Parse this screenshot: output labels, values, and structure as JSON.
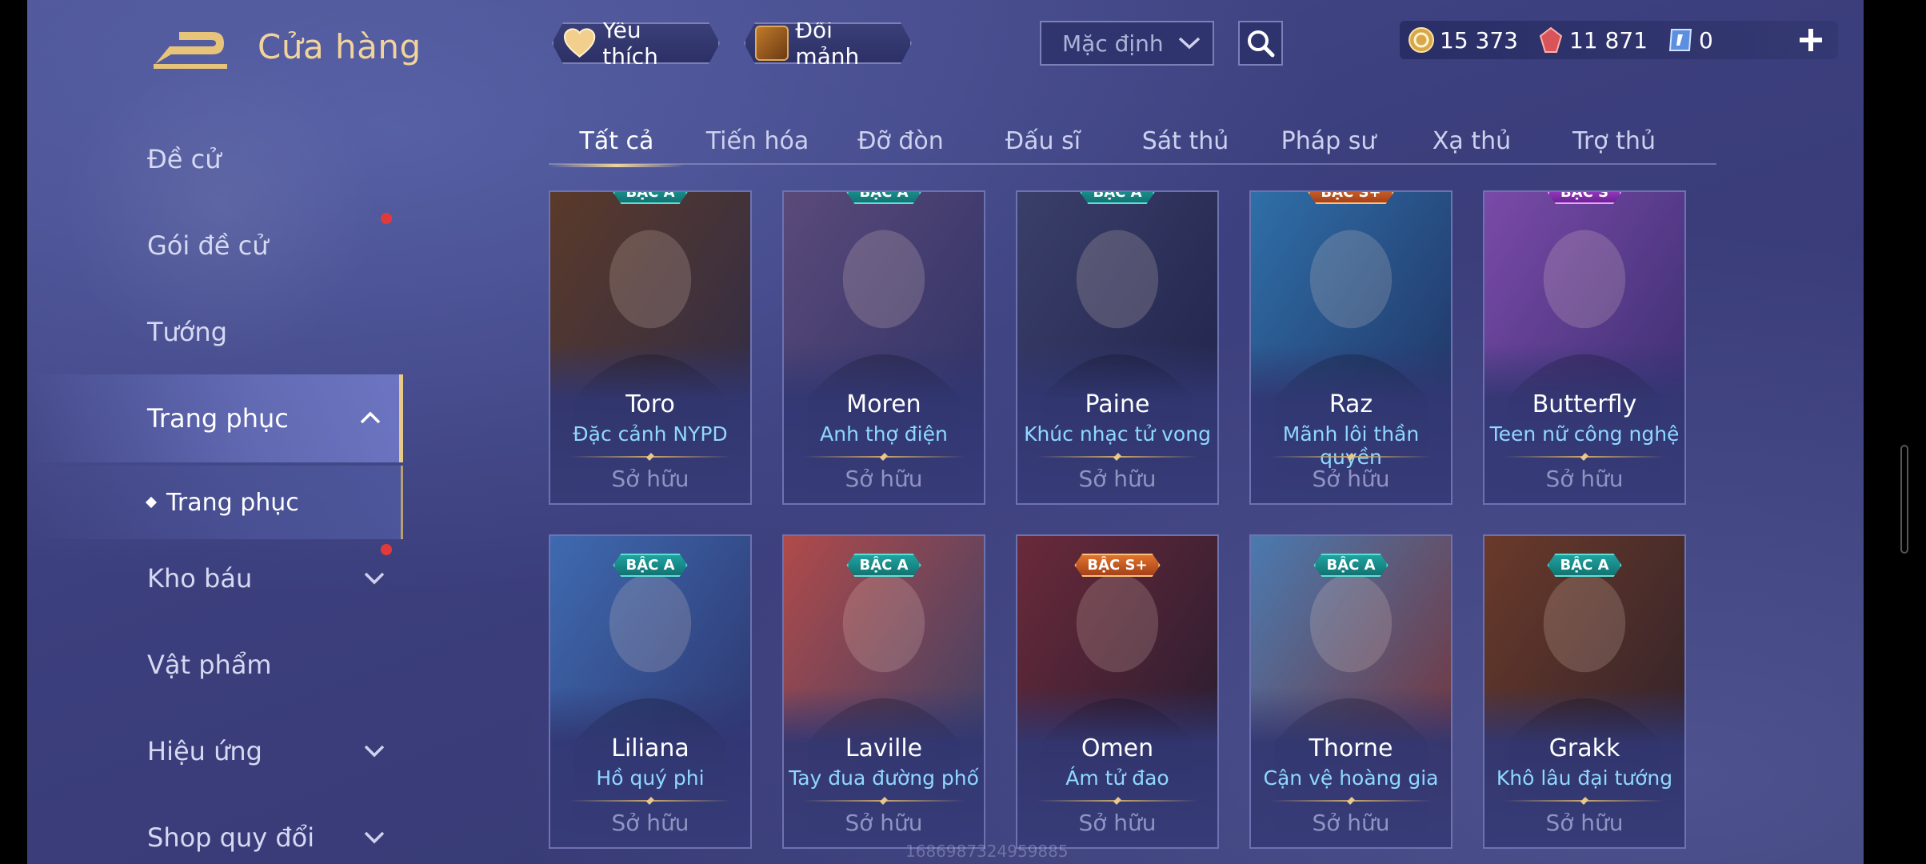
{
  "header": {
    "title": "Cửa hàng",
    "favorite_label": "Yêu thích",
    "shard_label": "Đổi mảnh",
    "sort": {
      "selected": "Mặc định"
    }
  },
  "currency": [
    {
      "icon": "gold-coin-icon",
      "value": "15 373"
    },
    {
      "icon": "ruby-gem-icon",
      "value": "11 871"
    },
    {
      "icon": "voucher-icon",
      "value": "0"
    }
  ],
  "sidebar": {
    "items": [
      {
        "label": "Đề cử"
      },
      {
        "label": "Gói đề cử"
      },
      {
        "label": "Tướng"
      },
      {
        "label": "Trang phục"
      },
      {
        "label": "Trang phục"
      },
      {
        "label": "Kho báu"
      },
      {
        "label": "Vật phẩm"
      },
      {
        "label": "Hiệu ứng"
      },
      {
        "label": "Shop quy đổi"
      }
    ]
  },
  "tabs": [
    {
      "label": "Tất cả"
    },
    {
      "label": "Tiến hóa"
    },
    {
      "label": "Đỡ đòn"
    },
    {
      "label": "Đấu sĩ"
    },
    {
      "label": "Sát thủ"
    },
    {
      "label": "Pháp sư"
    },
    {
      "label": "Xạ thủ"
    },
    {
      "label": "Trợ thủ"
    }
  ],
  "cards": [
    {
      "name": "Toro",
      "skin": "Đặc cảnh NYPD",
      "status": "Sở hữu",
      "badge": "BẬC A",
      "tier": "a",
      "palette": [
        "#5a3a2a",
        "#2b2a4a"
      ]
    },
    {
      "name": "Moren",
      "skin": "Anh thợ điện",
      "status": "Sở hữu",
      "badge": "BẬC A",
      "tier": "a",
      "palette": [
        "#5a4a7a",
        "#2b2f63"
      ]
    },
    {
      "name": "Paine",
      "skin": "Khúc nhạc tử vong",
      "status": "Sở hữu",
      "badge": "BẬC A",
      "tier": "a",
      "palette": [
        "#3a3f6a",
        "#1e2148"
      ]
    },
    {
      "name": "Raz",
      "skin": "Mãnh lôi thần quyền",
      "status": "Sở hữu",
      "badge": "BẬC S+",
      "tier": "splus",
      "palette": [
        "#2f6fa8",
        "#1f2c5c"
      ]
    },
    {
      "name": "Butterfly",
      "skin": "Teen nữ công nghệ",
      "status": "Sở hữu",
      "badge": "BẬC S",
      "tier": "s",
      "palette": [
        "#7a4aa8",
        "#332b6a"
      ]
    },
    {
      "name": "Liliana",
      "skin": "Hồ quý phi",
      "status": "Sở hữu",
      "badge": "BẬC A",
      "tier": "a",
      "palette": [
        "#3f6ab0",
        "#2a2f66"
      ]
    },
    {
      "name": "Laville",
      "skin": "Tay đua đường phố",
      "status": "Sở hữu",
      "badge": "BẬC A",
      "tier": "a",
      "palette": [
        "#b04a4a",
        "#2a3f6a"
      ]
    },
    {
      "name": "Omen",
      "skin": "Ám tử đao",
      "status": "Sở hữu",
      "badge": "BẬC S+",
      "tier": "splus",
      "palette": [
        "#6a2a3a",
        "#1e1a2e"
      ]
    },
    {
      "name": "Thorne",
      "skin": "Cận vệ hoàng gia",
      "status": "Sở hữu",
      "badge": "BẬC A",
      "tier": "a",
      "palette": [
        "#4a7ab0",
        "#7a2a2a"
      ]
    },
    {
      "name": "Grakk",
      "skin": "Khô lâu đại tướng",
      "status": "Sở hữu",
      "badge": "BẬC A",
      "tier": "a",
      "palette": [
        "#6a3a2a",
        "#2a1f2a"
      ]
    }
  ],
  "watermark": "1686987324959885"
}
